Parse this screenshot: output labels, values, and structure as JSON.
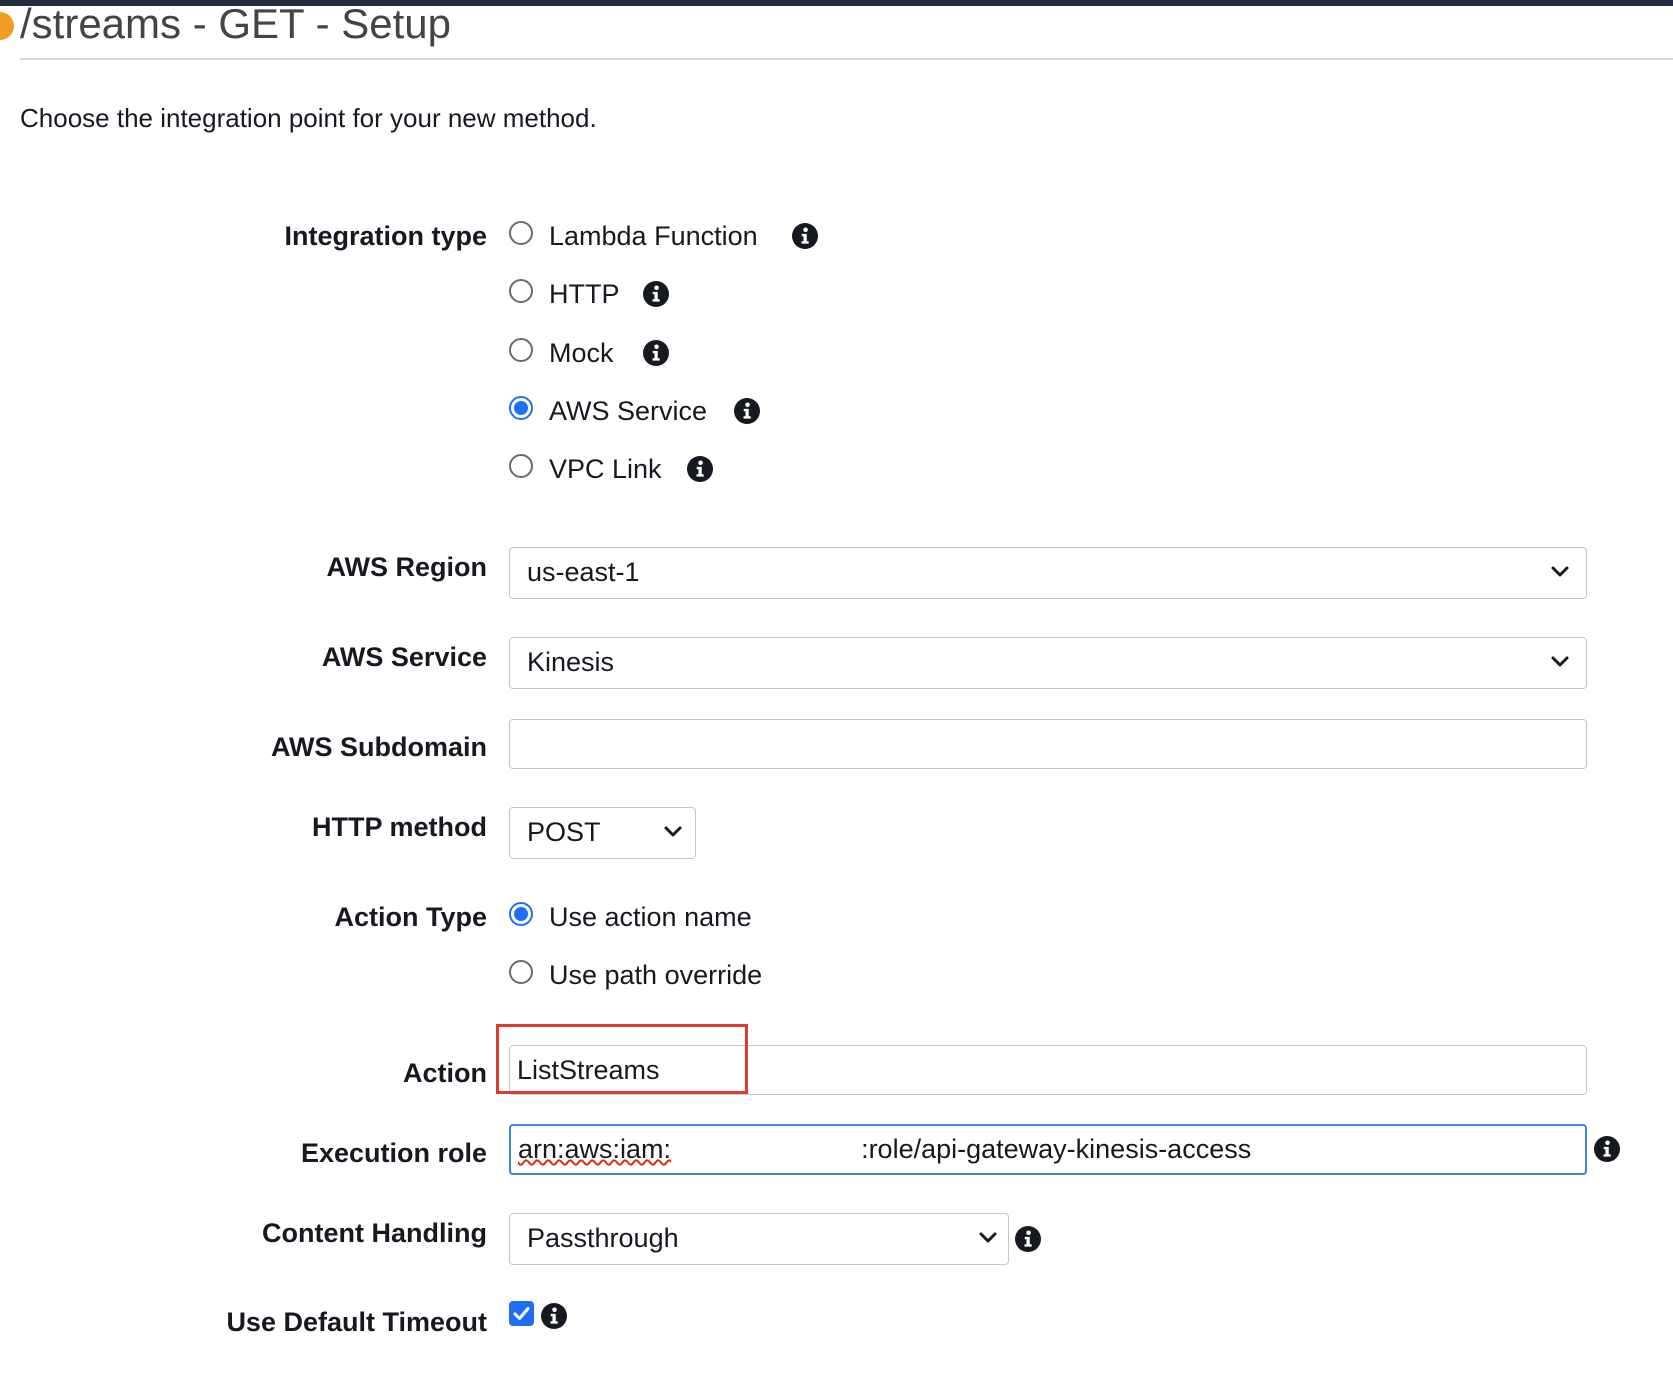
{
  "header": {
    "title": "/streams - GET - Setup"
  },
  "intro": "Choose the integration point for your new method.",
  "integration_type": {
    "label": "Integration type",
    "options": [
      {
        "label": "Lambda Function",
        "selected": false
      },
      {
        "label": "HTTP",
        "selected": false
      },
      {
        "label": "Mock",
        "selected": false
      },
      {
        "label": "AWS Service",
        "selected": true
      },
      {
        "label": "VPC Link",
        "selected": false
      }
    ]
  },
  "aws_region": {
    "label": "AWS Region",
    "value": "us-east-1"
  },
  "aws_service": {
    "label": "AWS Service",
    "value": "Kinesis"
  },
  "aws_subdomain": {
    "label": "AWS Subdomain",
    "value": ""
  },
  "http_method": {
    "label": "HTTP method",
    "value": "POST"
  },
  "action_type": {
    "label": "Action Type",
    "options": [
      {
        "label": "Use action name",
        "selected": true
      },
      {
        "label": "Use path override",
        "selected": false
      }
    ]
  },
  "action": {
    "label": "Action",
    "value": "ListStreams"
  },
  "execution_role": {
    "label": "Execution role",
    "value_prefix": "arn:aws:iam:",
    "value_suffix": ":role/api-gateway-kinesis-access"
  },
  "content_handling": {
    "label": "Content Handling",
    "value": "Passthrough"
  },
  "default_timeout": {
    "label": "Use Default Timeout",
    "checked": true
  },
  "colors": {
    "accent": "#1f6ff2",
    "highlight_box": "#dd3b2d",
    "header_bar": "#232f3e"
  }
}
